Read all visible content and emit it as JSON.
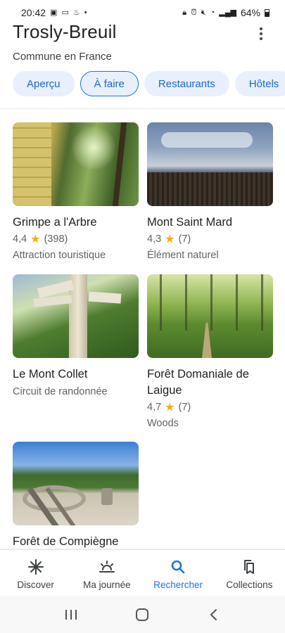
{
  "status_bar": {
    "time": "20:42",
    "battery": "64%"
  },
  "header": {
    "title": "Trosly-Breuil",
    "subtitle": "Commune en France"
  },
  "chips": [
    {
      "label": "Aperçu",
      "active": false
    },
    {
      "label": "À faire",
      "active": true
    },
    {
      "label": "Restaurants",
      "active": false
    },
    {
      "label": "Hôtels",
      "active": false
    }
  ],
  "places": [
    {
      "title": "Grimpe a l'Arbre",
      "rating": "4,4",
      "reviews": "(398)",
      "type": "Attraction touristique"
    },
    {
      "title": "Mont Saint Mard",
      "rating": "4,3",
      "reviews": "(7)",
      "type": "Élément naturel"
    },
    {
      "title": "Le Mont Collet",
      "type": "Circuit de randonnée"
    },
    {
      "title": "Forêt Domaniale de Laigue",
      "rating": "4,7",
      "reviews": "(7)",
      "type": "Woods"
    },
    {
      "title": "Forêt de Compiègne"
    }
  ],
  "bottom_nav": [
    {
      "label": "Discover",
      "icon": "discover-icon",
      "active": false
    },
    {
      "label": "Ma journée",
      "icon": "sunrise-icon",
      "active": false
    },
    {
      "label": "Rechercher",
      "icon": "search-icon",
      "active": true
    },
    {
      "label": "Collections",
      "icon": "bookmarks-icon",
      "active": false
    }
  ],
  "colors": {
    "accent": "#1a73e8",
    "chip_bg": "#e8f0fe",
    "star": "#f9ab00"
  }
}
